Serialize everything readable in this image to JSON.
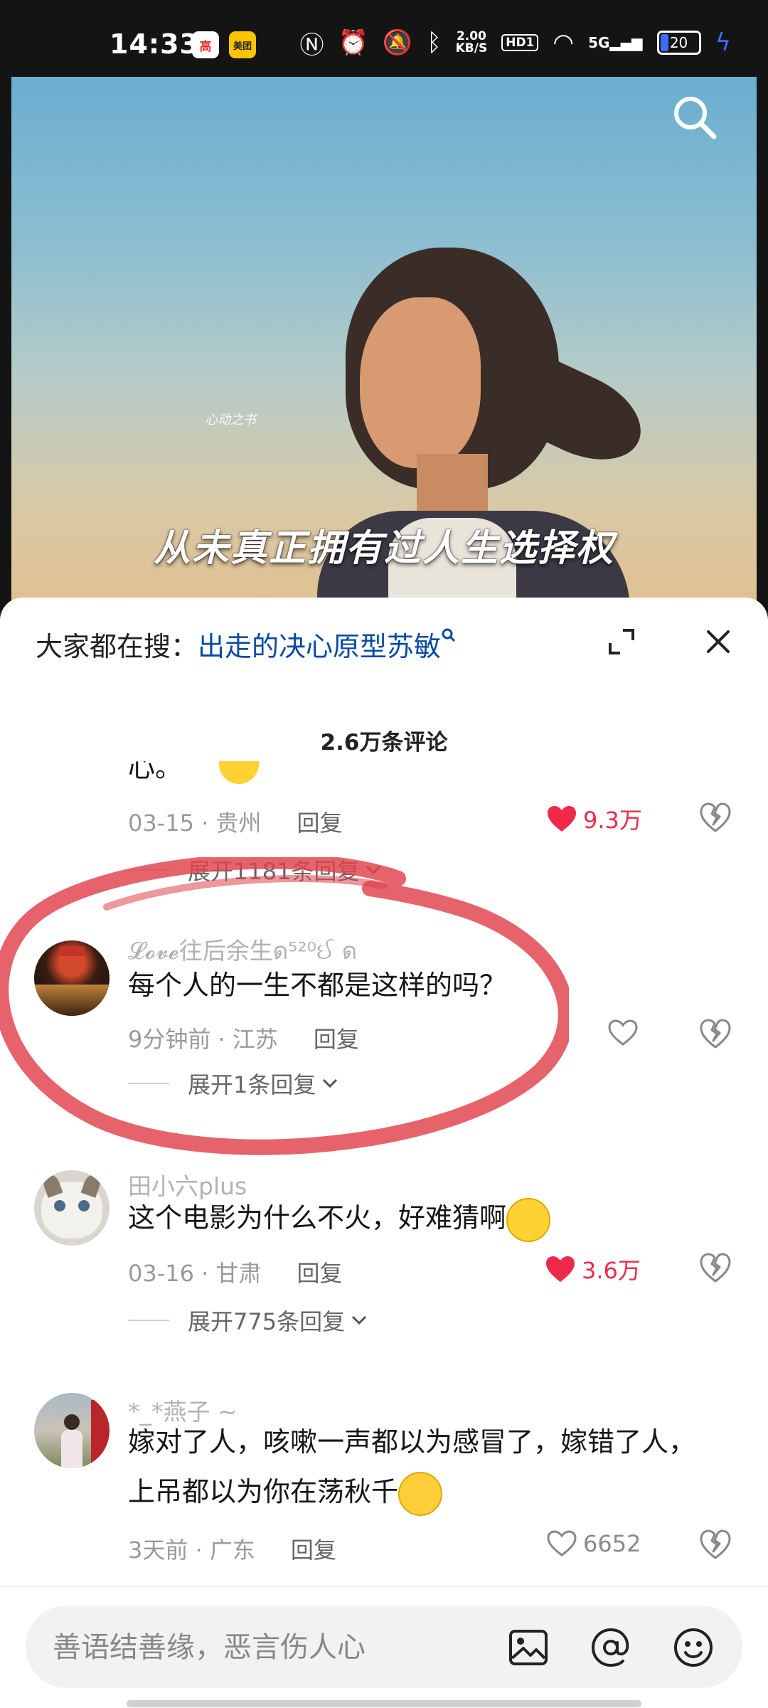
{
  "status_bar": {
    "time": "14:33",
    "app_badge_1": "高",
    "app_badge_2": "美团",
    "net_speed_value": "2.00",
    "net_speed_unit": "KB/S",
    "hd_label": "HD1",
    "signal_label": "5G",
    "battery": "20",
    "colors": {
      "battery_fill": "#3b6ef5"
    }
  },
  "video": {
    "watermark": "心动之书",
    "subtitle": "从未真正拥有过人生选择权"
  },
  "sheet": {
    "search_prefix": "大家都在搜：",
    "search_term": "出走的决心原型苏敏",
    "comment_count": "2.6万条评论"
  },
  "comments": [
    {
      "text_tail": "心。",
      "date": "03-15",
      "location": "贵州",
      "reply_label": "回复",
      "likes": "9.3万",
      "liked": true,
      "expand_label": "展开1181条回复"
    },
    {
      "nickname": "𝓛𝓸𝓿𝓮往后余生ด⁵²⁰ઈ ด",
      "text": "每个人的一生不都是这样的吗？",
      "date": "9分钟前",
      "location": "江苏",
      "reply_label": "回复",
      "likes": "",
      "liked": false,
      "expand_label": "展开1条回复"
    },
    {
      "nickname": "田小六plus",
      "text": "这个电影为什么不火，好难猜啊",
      "date": "03-16",
      "location": "甘肃",
      "reply_label": "回复",
      "likes": "3.6万",
      "liked": true,
      "expand_label": "展开775条回复"
    },
    {
      "nickname": "*_*燕子 ~",
      "text_line1": "嫁对了人，咳嗽一声都以为感冒了，嫁错了人，",
      "text_line2": "上吊都以为你在荡秋千",
      "date": "3天前",
      "location": "广东",
      "reply_label": "回复",
      "likes": "6652",
      "liked": false
    }
  ],
  "input": {
    "placeholder": "善语结善缘，恶言伤人心"
  },
  "colors": {
    "link_blue": "#0b4aa5",
    "like_red": "#f0294a",
    "annotation_red": "#e0414a"
  }
}
